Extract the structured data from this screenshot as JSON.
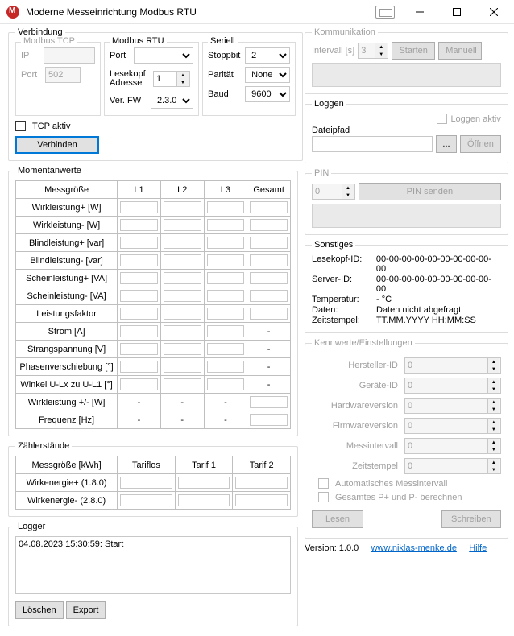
{
  "title": "Moderne Messeinrichtung Modbus RTU",
  "verbindung": {
    "legend": "Verbindung",
    "tcp": {
      "legend": "Modbus TCP",
      "ip_label": "IP",
      "ip": "",
      "port_label": "Port",
      "port": "502"
    },
    "rtu": {
      "legend": "Modbus RTU",
      "port_label": "Port",
      "port": "",
      "lese_addr_label": "Lesekopf\nAdresse",
      "lese_addr": "1",
      "fw_label": "Ver. FW",
      "fw": "2.3.0"
    },
    "seriell": {
      "legend": "Seriell",
      "stop_label": "Stoppbit",
      "stop": "2",
      "parity_label": "Parität",
      "parity": "None",
      "baud_label": "Baud",
      "baud": "9600"
    },
    "tcp_aktiv": "TCP aktiv",
    "verbinden": "Verbinden"
  },
  "moment": {
    "legend": "Momentanwerte",
    "headers": [
      "Messgröße",
      "L1",
      "L2",
      "L3",
      "Gesamt"
    ],
    "rows": [
      {
        "name": "Wirkleistung+ [W]",
        "l1": "i",
        "l2": "i",
        "l3": "i",
        "g": "i"
      },
      {
        "name": "Wirkleistung- [W]",
        "l1": "i",
        "l2": "i",
        "l3": "i",
        "g": "i"
      },
      {
        "name": "Blindleistung+ [var]",
        "l1": "i",
        "l2": "i",
        "l3": "i",
        "g": "i"
      },
      {
        "name": "Blindleistung- [var]",
        "l1": "i",
        "l2": "i",
        "l3": "i",
        "g": "i"
      },
      {
        "name": "Scheinleistung+ [VA]",
        "l1": "i",
        "l2": "i",
        "l3": "i",
        "g": "i"
      },
      {
        "name": "Scheinleistung- [VA]",
        "l1": "i",
        "l2": "i",
        "l3": "i",
        "g": "i"
      },
      {
        "name": "Leistungsfaktor",
        "l1": "i",
        "l2": "i",
        "l3": "i",
        "g": "i"
      },
      {
        "name": "Strom [A]",
        "l1": "i",
        "l2": "i",
        "l3": "i",
        "g": "-"
      },
      {
        "name": "Strangspannung [V]",
        "l1": "i",
        "l2": "i",
        "l3": "i",
        "g": "-"
      },
      {
        "name": "Phasenverschiebung [°]",
        "l1": "i",
        "l2": "i",
        "l3": "i",
        "g": "-"
      },
      {
        "name": "Winkel U-Lx zu U-L1 [°]",
        "l1": "i",
        "l2": "i",
        "l3": "i",
        "g": "-"
      },
      {
        "name": "Wirkleistung +/- [W]",
        "l1": "-",
        "l2": "-",
        "l3": "-",
        "g": "i"
      },
      {
        "name": "Frequenz [Hz]",
        "l1": "-",
        "l2": "-",
        "l3": "-",
        "g": "i"
      }
    ]
  },
  "zaehler": {
    "legend": "Zählerstände",
    "headers": [
      "Messgröße [kWh]",
      "Tariflos",
      "Tarif 1",
      "Tarif 2"
    ],
    "rows": [
      "Wirkenergie+ (1.8.0)",
      "Wirkenergie- (2.8.0)"
    ]
  },
  "logger": {
    "legend": "Logger",
    "text": "04.08.2023 15:30:59: Start",
    "loeschen": "Löschen",
    "export": "Export"
  },
  "komm": {
    "legend": "Kommunikation",
    "int_label": "Intervall [s]",
    "int": "3",
    "starten": "Starten",
    "manuell": "Manuell"
  },
  "loggen": {
    "legend": "Loggen",
    "aktiv": "Loggen aktiv",
    "pfad_label": "Dateipfad",
    "pfad": "",
    "browse": "...",
    "open": "Öffnen"
  },
  "pin": {
    "legend": "PIN",
    "value": "0",
    "send": "PIN senden"
  },
  "sonst": {
    "legend": "Sonstiges",
    "lesekopf": {
      "k": "Lesekopf-ID:",
      "v": "00-00-00-00-00-00-00-00-00-00"
    },
    "server": {
      "k": "Server-ID:",
      "v": "00-00-00-00-00-00-00-00-00-00"
    },
    "temp": {
      "k": "Temperatur:",
      "v": "- °C"
    },
    "daten": {
      "k": "Daten:",
      "v": "Daten nicht abgefragt"
    },
    "zeit": {
      "k": "Zeitstempel:",
      "v": "TT.MM.YYYY HH:MM:SS"
    }
  },
  "kennw": {
    "legend": "Kennwerte/Einstellungen",
    "rows": [
      {
        "label": "Hersteller-ID",
        "val": "0"
      },
      {
        "label": "Geräte-ID",
        "val": "0"
      },
      {
        "label": "Hardwareversion",
        "val": "0"
      },
      {
        "label": "Firmwareversion",
        "val": "0"
      },
      {
        "label": "Messintervall",
        "val": "0"
      },
      {
        "label": "Zeitstempel",
        "val": "0"
      }
    ],
    "auto": "Automatisches Messintervall",
    "pberech": "Gesamtes P+ und P- berechnen",
    "lesen": "Lesen",
    "schreiben": "Schreiben"
  },
  "footer": {
    "version": "Version: 1.0.0",
    "link": "www.niklas-menke.de",
    "hilfe": "Hilfe"
  }
}
